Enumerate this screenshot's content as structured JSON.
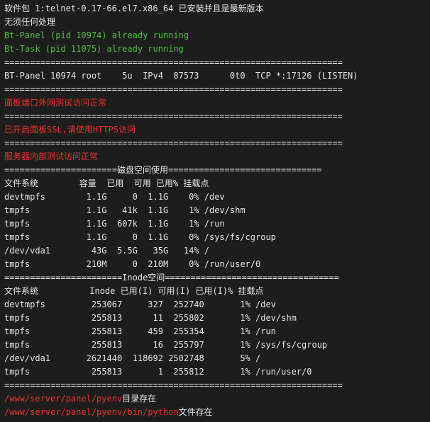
{
  "colors": {
    "background": "#1d1d1d",
    "text": "#e6e6e6",
    "green": "#4cc33a",
    "red": "#e8332a"
  },
  "lines": [
    {
      "segments": [
        {
          "text": "软件包 1:telnet-0.17-66.el7.x86_64 已安装并且是最新版本",
          "color": "white"
        }
      ]
    },
    {
      "segments": [
        {
          "text": "无须任何处理",
          "color": "white"
        }
      ]
    },
    {
      "segments": [
        {
          "text": "Bt-Panel (pid 10974) already running",
          "color": "green"
        }
      ]
    },
    {
      "segments": [
        {
          "text": "Bt-Task (pid 11075) already running",
          "color": "green"
        }
      ]
    },
    {
      "segments": [
        {
          "text": "==================================================================",
          "color": "white"
        }
      ]
    },
    {
      "segments": [
        {
          "text": "BT-Panel 10974 root    5u  IPv4  87573      0t0  TCP *:17126 (LISTEN)",
          "color": "white"
        }
      ]
    },
    {
      "segments": [
        {
          "text": "==================================================================",
          "color": "white"
        }
      ]
    },
    {
      "segments": [
        {
          "text": "面板端口外网测试访问正常",
          "color": "red"
        }
      ]
    },
    {
      "segments": [
        {
          "text": "==================================================================",
          "color": "white"
        }
      ]
    },
    {
      "segments": [
        {
          "text": "已开启面板SSL,请使用HTTPS访问",
          "color": "red"
        }
      ]
    },
    {
      "segments": [
        {
          "text": "==================================================================",
          "color": "white"
        }
      ]
    },
    {
      "segments": [
        {
          "text": "服务器内部测试访问正常",
          "color": "red"
        }
      ]
    },
    {
      "segments": [
        {
          "text": "======================磁盘空间使用==============================",
          "color": "white"
        }
      ]
    },
    {
      "segments": [
        {
          "text": "文件系统        容量  已用  可用 已用% 挂载点",
          "color": "white"
        }
      ]
    },
    {
      "segments": [
        {
          "text": "devtmpfs        1.1G     0  1.1G    0% /dev",
          "color": "white"
        }
      ]
    },
    {
      "segments": [
        {
          "text": "tmpfs           1.1G   41k  1.1G    1% /dev/shm",
          "color": "white"
        }
      ]
    },
    {
      "segments": [
        {
          "text": "tmpfs           1.1G  607k  1.1G    1% /run",
          "color": "white"
        }
      ]
    },
    {
      "segments": [
        {
          "text": "tmpfs           1.1G     0  1.1G    0% /sys/fs/cgroup",
          "color": "white"
        }
      ]
    },
    {
      "segments": [
        {
          "text": "/dev/vda1        43G  5.5G   35G   14% /",
          "color": "white"
        }
      ]
    },
    {
      "segments": [
        {
          "text": "tmpfs           210M     0  210M    0% /run/user/0",
          "color": "white"
        }
      ]
    },
    {
      "segments": [
        {
          "text": "=======================Inode空间==================================",
          "color": "white"
        }
      ]
    },
    {
      "segments": [
        {
          "text": "文件系统          Inode 已用(I) 可用(I) 已用(I)% 挂载点",
          "color": "white"
        }
      ]
    },
    {
      "segments": [
        {
          "text": "devtmpfs         253067     327  252740       1% /dev",
          "color": "white"
        }
      ]
    },
    {
      "segments": [
        {
          "text": "tmpfs            255813      11  255802       1% /dev/shm",
          "color": "white"
        }
      ]
    },
    {
      "segments": [
        {
          "text": "tmpfs            255813     459  255354       1% /run",
          "color": "white"
        }
      ]
    },
    {
      "segments": [
        {
          "text": "tmpfs            255813      16  255797       1% /sys/fs/cgroup",
          "color": "white"
        }
      ]
    },
    {
      "segments": [
        {
          "text": "/dev/vda1       2621440  118692 2502748       5% /",
          "color": "white"
        }
      ]
    },
    {
      "segments": [
        {
          "text": "tmpfs            255813       1  255812       1% /run/user/0",
          "color": "white"
        }
      ]
    },
    {
      "segments": [
        {
          "text": "==================================================================",
          "color": "white"
        }
      ]
    },
    {
      "segments": [
        {
          "text": "/www/server/panel/pyenv",
          "color": "red"
        },
        {
          "text": "目录存在",
          "color": "white"
        }
      ]
    },
    {
      "segments": [
        {
          "text": "/www/server/panel/pyenv/bin/python",
          "color": "red"
        },
        {
          "text": "文件存在",
          "color": "white"
        }
      ]
    }
  ]
}
